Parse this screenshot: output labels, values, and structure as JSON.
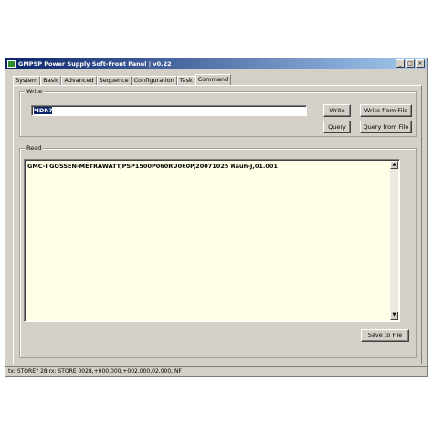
{
  "window": {
    "title": "GMPSP Power Supply Soft-Front Panel | v0.22",
    "minimize_glyph": "_",
    "maximize_glyph": "□",
    "close_glyph": "×"
  },
  "tabs": [
    {
      "label": "System",
      "active": false
    },
    {
      "label": "Basic",
      "active": false
    },
    {
      "label": "Advanced",
      "active": false
    },
    {
      "label": "Sequence",
      "active": false
    },
    {
      "label": "Configuration",
      "active": false
    },
    {
      "label": "Task",
      "active": false
    },
    {
      "label": "Command",
      "active": true
    }
  ],
  "write_group": {
    "label": "Write",
    "input_value": "*IDN?",
    "write_button": "Write",
    "query_button": "Query",
    "write_file_button": "Write from File",
    "query_file_button": "Query from File"
  },
  "read_group": {
    "label": "Read",
    "text": "GMC-I GOSSEN-METRAWATT,PSP1500P060RU060P,20071025 Rauh-J,01.001",
    "save_button": "Save to File",
    "scroll_up_glyph": "▲",
    "scroll_down_glyph": "▼"
  },
  "status": {
    "text": "tx: STORE? 28  rx: STORE 0028,+000.000,+002.000,02.000,  NF"
  }
}
